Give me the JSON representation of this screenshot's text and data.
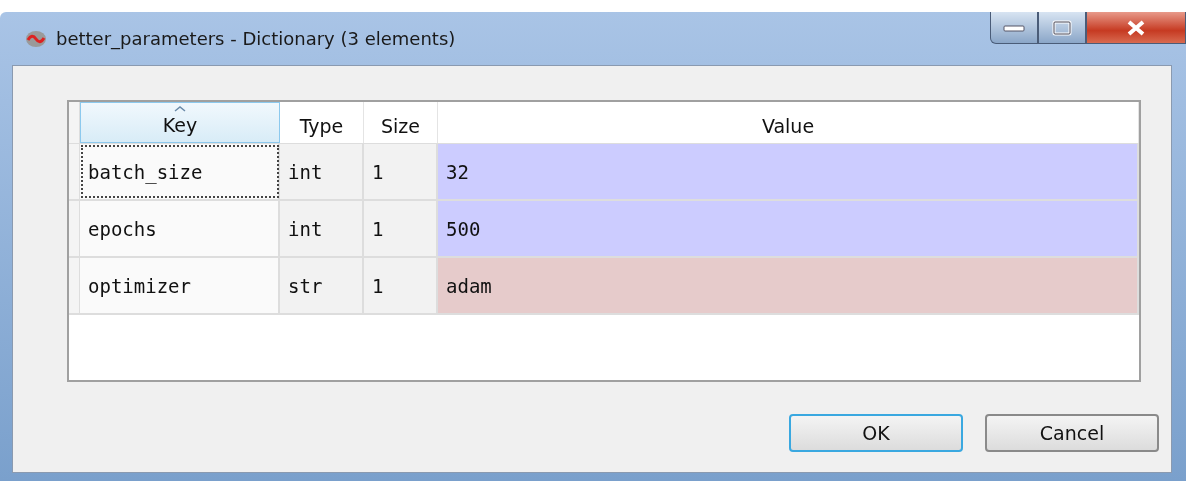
{
  "window": {
    "title": "better_parameters - Dictionary (3 elements)"
  },
  "table": {
    "columns": [
      {
        "label": "Key",
        "sorted": true
      },
      {
        "label": "Type",
        "sorted": false
      },
      {
        "label": "Size",
        "sorted": false
      },
      {
        "label": "Value",
        "sorted": false
      }
    ],
    "rows": [
      {
        "key": "batch_size",
        "type": "int",
        "size": "1",
        "value": "32",
        "color": "#ccccff",
        "selected": true
      },
      {
        "key": "epochs",
        "type": "int",
        "size": "1",
        "value": "500",
        "color": "#ccccff",
        "selected": false
      },
      {
        "key": "optimizer",
        "type": "str",
        "size": "1",
        "value": "adam",
        "color": "#e6cbcb",
        "selected": false
      }
    ]
  },
  "buttons": [
    {
      "label": "OK",
      "default": true
    },
    {
      "label": "Cancel",
      "default": false
    }
  ]
}
